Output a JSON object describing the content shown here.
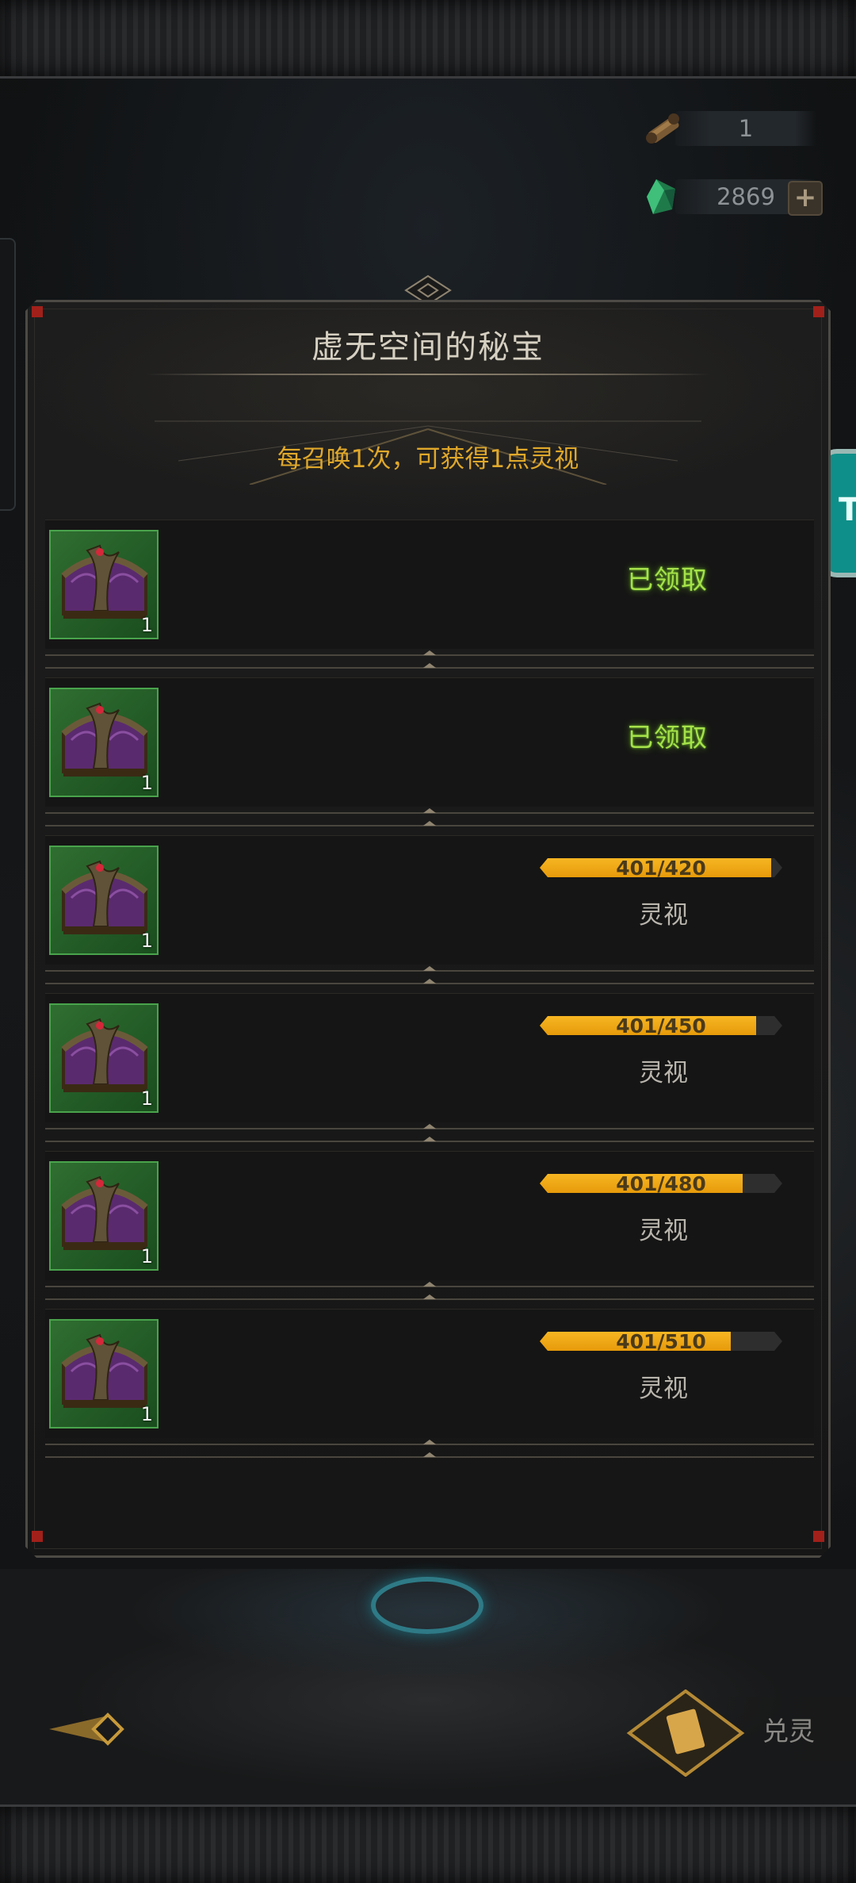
{
  "currencies": [
    {
      "name": "scroll-ticket",
      "value": "1",
      "has_plus": false
    },
    {
      "name": "green-crystal",
      "value": "2869",
      "has_plus": true
    }
  ],
  "side_button": {
    "label": "T"
  },
  "modal": {
    "title": "虚无空间的秘宝",
    "subtitle": "每召唤1次，可获得1点灵视"
  },
  "rewards": [
    {
      "count": "1",
      "status": "claimed",
      "claimed_text": "已领取"
    },
    {
      "count": "1",
      "status": "claimed",
      "claimed_text": "已领取"
    },
    {
      "count": "1",
      "status": "progress",
      "progress_text": "401/420",
      "current": 401,
      "target": 420,
      "label": "灵视"
    },
    {
      "count": "1",
      "status": "progress",
      "progress_text": "401/450",
      "current": 401,
      "target": 450,
      "label": "灵视"
    },
    {
      "count": "1",
      "status": "progress",
      "progress_text": "401/480",
      "current": 401,
      "target": 480,
      "label": "灵视"
    },
    {
      "count": "1",
      "status": "progress",
      "progress_text": "401/510",
      "current": 401,
      "target": 510,
      "label": "灵视"
    }
  ],
  "bottom": {
    "exchange_label": "兑灵"
  },
  "colors": {
    "accent_gold": "#e0a82a",
    "claimed_green": "#a6e24a",
    "progress_orange": "#f2ad1c"
  }
}
